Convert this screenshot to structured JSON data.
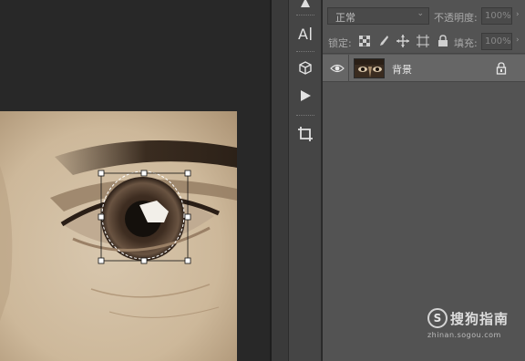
{
  "layers_panel": {
    "blend_mode": "正常",
    "opacity_label": "不透明度:",
    "opacity_value": "100%",
    "lock_label": "锁定:",
    "fill_label": "填充:",
    "fill_value": "100%",
    "layers": [
      {
        "name": "背景",
        "visible": true,
        "locked": true
      }
    ]
  },
  "tools": [
    "text-tool-icon",
    "3d-object-icon",
    "play-icon",
    "crop-tool-icon"
  ],
  "watermark": {
    "logo_glyph": "S",
    "brand": "搜狗指南",
    "url": "zhinan.sogou.com"
  },
  "colors": {
    "panel_bg": "#535353",
    "tool_bg": "#454545",
    "canvas_bg": "#282828",
    "layer_selected": "#666666"
  }
}
